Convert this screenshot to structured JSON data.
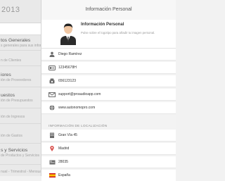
{
  "sidebar": {
    "year": "2013",
    "items": [
      {
        "title": "",
        "subtitle": ""
      },
      {
        "title": "tos Generales",
        "subtitle": "s generales para sus informes"
      },
      {
        "title": "",
        "subtitle": "n de Clientes"
      },
      {
        "title": "iores",
        "subtitle": "ión de Proveedores"
      },
      {
        "title": "uestos",
        "subtitle": "ión de Presupuestos"
      },
      {
        "title": "",
        "subtitle": "ión de Ingresos"
      },
      {
        "title": "",
        "subtitle": "ión de Gastos"
      },
      {
        "title": "s y Servicios",
        "subtitle": "de Productos y Servicios"
      },
      {
        "title": "",
        "subtitle": "nual - Trimestral - Mensual"
      }
    ]
  },
  "header": {
    "title": "Información Personal"
  },
  "profile": {
    "title": "Información Personal",
    "subtitle": "Pulse sobre el logotipo para añadir tu imagen personal."
  },
  "contact": {
    "name": "Diego Ramírez",
    "nif": "12345678H",
    "phone": "656123123",
    "email": "support@proaudioapp.com",
    "web": "www.autonomopro.com"
  },
  "location": {
    "heading": "INFORMACIÓN DE LOCALIZACIÓN",
    "address": "Gran Vía 45",
    "city": "Madrid",
    "postal_code": "28035",
    "country": "España"
  },
  "colors": {
    "icon": "#6b6b6b",
    "pin": "#d9534f"
  }
}
